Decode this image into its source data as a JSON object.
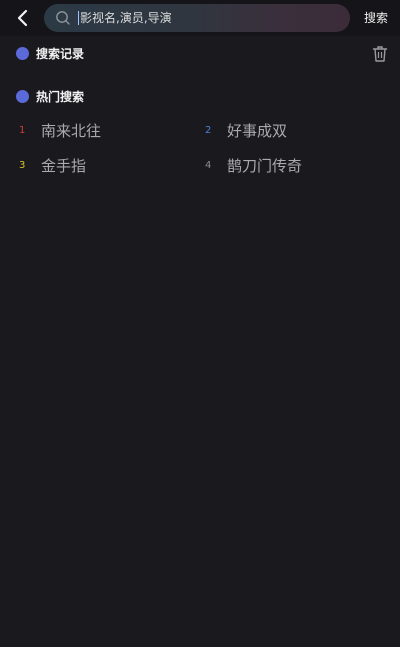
{
  "search": {
    "placeholder": "影视名,演员,导演",
    "button_label": "搜索"
  },
  "history": {
    "title": "搜索记录"
  },
  "hot": {
    "title": "热门搜索",
    "items": [
      {
        "rank": "1",
        "label": "南来北往",
        "rank_color": "#d23b3b"
      },
      {
        "rank": "2",
        "label": "好事成双",
        "rank_color": "#4d7fd6"
      },
      {
        "rank": "3",
        "label": "金手指",
        "rank_color": "#d9c12a"
      },
      {
        "rank": "4",
        "label": "鹊刀门传奇",
        "rank_color": "#8a8a8e"
      }
    ]
  },
  "icons": {
    "back": "chevron-left-icon",
    "search": "search-icon",
    "clear_history": "trash-icon"
  },
  "colors": {
    "background": "#1a191e",
    "accent_dot": "#5b6ad9",
    "item_text": "#a9a9ae"
  }
}
